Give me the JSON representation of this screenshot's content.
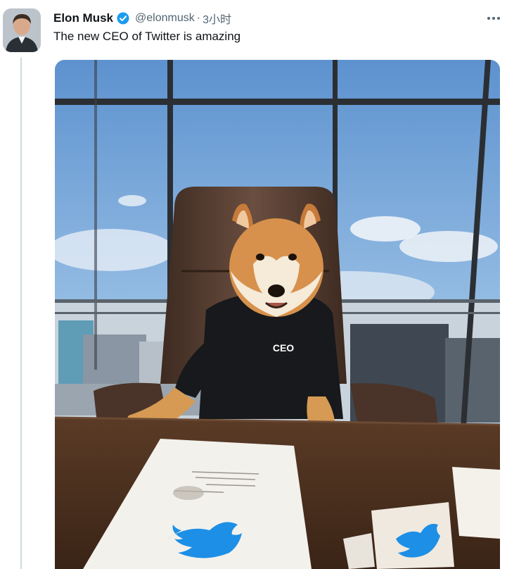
{
  "tweet": {
    "author_name": "Elon Musk",
    "handle": "@elonmusk",
    "separator": "·",
    "time": "3小时",
    "text": "The new CEO of Twitter is amazing",
    "verified_icon": "verified-badge-icon",
    "more_icon": "more-options-icon"
  },
  "media": {
    "sweater_text": "CEO",
    "logo_icon": "twitter-bird-icon"
  },
  "colors": {
    "verified": "#1d9bf0",
    "twitter_blue": "#1d8fe6",
    "text_secondary": "#536471"
  }
}
